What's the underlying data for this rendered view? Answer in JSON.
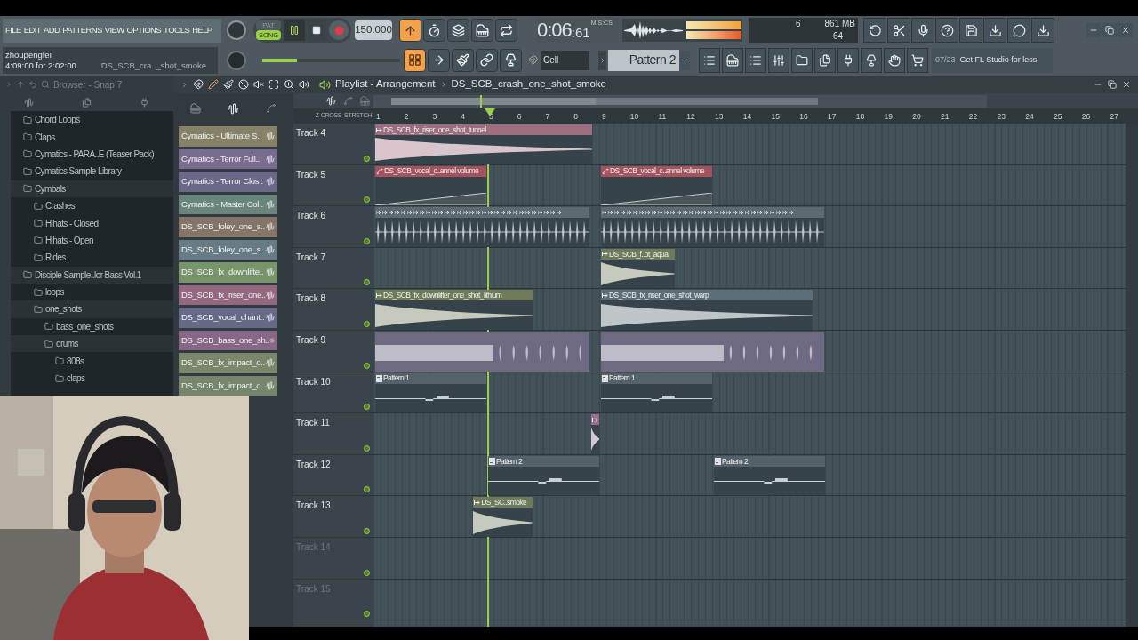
{
  "toolbar": {
    "menu": [
      "FILE",
      "EDIT",
      "ADD",
      "PATTERNS",
      "VIEW",
      "OPTIONS",
      "TOOLS",
      "HELP"
    ],
    "hint": {
      "user": "zhoupengfei",
      "time": "4:09:00 for 2:02:00",
      "file": "DS_SCB_cra.._shot_smoke"
    },
    "mode": [
      {
        "label": "PAT",
        "selected": false
      },
      {
        "label": "SONG",
        "selected": true
      }
    ],
    "playing": true,
    "tempo": "150.000",
    "master_pitch": {
      "level": 0.25
    },
    "time": {
      "main": "0:06",
      "centis": ":61",
      "unit": "M:S:CS"
    },
    "cpu": "6",
    "memory": "861 MB",
    "polyphony": "64",
    "snap": "Cell",
    "pattern": "Pattern 2",
    "news": {
      "date": "07/23",
      "text": "Get FL Studio for less!"
    }
  },
  "browser": {
    "title": "Browser - Snap 7",
    "tree": [
      {
        "label": "Chord Loops",
        "expanded": false
      },
      {
        "label": "Claps",
        "expanded": false
      },
      {
        "label": "Cymatics - PARA..E (Teaser Pack)",
        "expanded": false
      },
      {
        "label": "Cymatics Sample Library",
        "expanded": false
      },
      {
        "label": "Cymbals",
        "expanded": true,
        "children": [
          {
            "label": "Crashes",
            "expanded": false
          },
          {
            "label": "Hihats - Closed",
            "expanded": false
          },
          {
            "label": "Hihats - Open",
            "expanded": false
          },
          {
            "label": "Rides",
            "expanded": false
          }
        ]
      },
      {
        "label": "Disciple Sample..lor Bass Vol.1",
        "expanded": true,
        "children": [
          {
            "label": "loops",
            "expanded": false
          },
          {
            "label": "one_shots",
            "expanded": true,
            "children": [
              {
                "label": "bass_one_shots",
                "expanded": false
              },
              {
                "label": "drums",
                "expanded": true,
                "children": [
                  {
                    "label": "808s",
                    "expanded": false
                  },
                  {
                    "label": "claps",
                    "expanded": false
                  }
                ]
              }
            ]
          }
        ]
      }
    ]
  },
  "channels": [
    {
      "name": "Cymatics - Ultimate S..",
      "color": "#86826a"
    },
    {
      "name": "Cymatics - Terror Full..",
      "color": "#7a6c8e"
    },
    {
      "name": "Cymatics - Terror Clos..",
      "color": "#6c6888"
    },
    {
      "name": "Cymatics - Master Col..",
      "color": "#6a857c"
    },
    {
      "name": "DS_SCB_foley_one_s..",
      "color": "#857468"
    },
    {
      "name": "DS_SCB_foley_one_s..",
      "color": "#687c86"
    },
    {
      "name": "DS_SCB_fx_downlifte..",
      "color": "#78946a"
    },
    {
      "name": "DS_SCB_fx_riser_one..",
      "color": "#94687e"
    },
    {
      "name": "DS_SCB_vocal_chant..",
      "color": "#666a86"
    },
    {
      "name": "DS_SCB_bass_one_sh..",
      "color": "#866886"
    },
    {
      "name": "DS_SCB_fx_impact_o..",
      "color": "#7c866a"
    },
    {
      "name": "DS_SCB_fx_impact_o..",
      "color": "#76866c"
    }
  ],
  "playlist": {
    "title": "Playlist - Arrangement",
    "clip_name": "DS_SCB_crash_one_shot_smoke",
    "z_cross": "Z-CROSS",
    "stretch": "STRETCH",
    "bars": [
      "1",
      "2",
      "3",
      "4",
      "5",
      "6",
      "7",
      "8",
      "9",
      "10",
      "11",
      "12",
      "13",
      "14",
      "15",
      "16",
      "17",
      "18",
      "19",
      "20",
      "21",
      "22",
      "23",
      "24",
      "25",
      "26",
      "27"
    ],
    "tracks": [
      {
        "name": "Track 4",
        "enabled": true,
        "clips": [
          {
            "kind": "audio",
            "label": "DS_SCB_fx_riser_one_shot_tunnel",
            "color": "#9c6e7e"
          }
        ]
      },
      {
        "name": "Track 5",
        "enabled": true,
        "clips": [
          {
            "kind": "automation",
            "label": "DS_SCB_vocal_c..annel volume",
            "color": "#a4525e"
          },
          {
            "kind": "automation",
            "label": "DS_SCB_vocal_c..annel volume",
            "color": "#a4525e"
          }
        ]
      },
      {
        "name": "Track 6",
        "enabled": true,
        "clips": [
          {
            "kind": "beat",
            "color": "#5c6a72"
          },
          {
            "kind": "beat",
            "color": "#5c6a72"
          }
        ]
      },
      {
        "name": "Track 7",
        "enabled": true,
        "clips": [
          {
            "kind": "audio",
            "label": "DS_SCB_f..ot_aqua",
            "color": "#6e7a5a"
          }
        ]
      },
      {
        "name": "Track 8",
        "enabled": true,
        "clips": [
          {
            "kind": "audio",
            "label": "DS_SCB_fx_downlifter_one_shot_lithium",
            "color": "#6e7a5a"
          },
          {
            "kind": "audio",
            "label": "DS_SCB_fx_riser_one_shot_warp",
            "color": "#5e6e78"
          }
        ]
      },
      {
        "name": "Track 9",
        "enabled": true,
        "clips": [
          {
            "kind": "sliced",
            "color": "#6e6a82"
          },
          {
            "kind": "sliced",
            "color": "#6e6a82"
          }
        ]
      },
      {
        "name": "Track 10",
        "enabled": true,
        "clips": [
          {
            "kind": "pattern",
            "label": "Pattern 1",
            "color": "#56626a"
          },
          {
            "kind": "pattern",
            "label": "Pattern 1",
            "color": "#56626a"
          }
        ]
      },
      {
        "name": "Track 11",
        "enabled": true,
        "clips": [
          {
            "kind": "audio",
            "color": "#9c6e8e"
          }
        ]
      },
      {
        "name": "Track 12",
        "enabled": true,
        "clips": [
          {
            "kind": "pattern",
            "label": "Pattern 2",
            "color": "#56626a"
          },
          {
            "kind": "pattern",
            "label": "Pattern 2",
            "color": "#56626a"
          }
        ]
      },
      {
        "name": "Track 13",
        "enabled": true,
        "clips": [
          {
            "kind": "audio",
            "label": "DS_SC..smoke",
            "color": "#6e7a5a"
          }
        ]
      },
      {
        "name": "Track 14",
        "enabled": false
      },
      {
        "name": "Track 15",
        "enabled": false
      }
    ]
  }
}
